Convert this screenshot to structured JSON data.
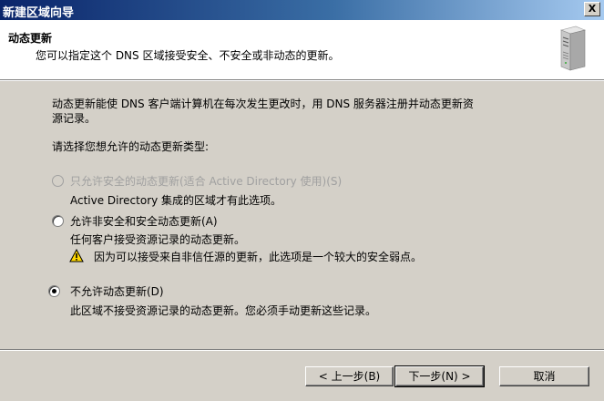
{
  "window": {
    "title": "新建区域向导",
    "close_label": "X"
  },
  "header": {
    "title": "动态更新",
    "subtitle": "您可以指定这个 DNS 区域接受安全、不安全或非动态的更新。",
    "icon": "server-icon"
  },
  "body": {
    "intro_line1": "动态更新能使 DNS 客户端计算机在每次发生更改时，用 DNS 服务器注册并动态更新资",
    "intro_line2": "源记录。",
    "prompt": "请选择您想允许的动态更新类型:",
    "options": [
      {
        "label": "只允许安全的动态更新(适合 Active Directory 使用)(S)",
        "description": "Active Directory 集成的区域才有此选项。",
        "selected": false,
        "enabled": false
      },
      {
        "label": "允许非安全和安全动态更新(A)",
        "description": "任何客户接受资源记录的动态更新。",
        "warning": "因为可以接受来自非信任源的更新，此选项是一个较大的安全弱点。",
        "selected": false,
        "enabled": true
      },
      {
        "label": "不允许动态更新(D)",
        "description": "此区域不接受资源记录的动态更新。您必须手动更新这些记录。",
        "selected": true,
        "enabled": true
      }
    ]
  },
  "footer": {
    "back_label": "< 上一步(B)",
    "next_label": "下一步(N) >",
    "cancel_label": "取消"
  }
}
